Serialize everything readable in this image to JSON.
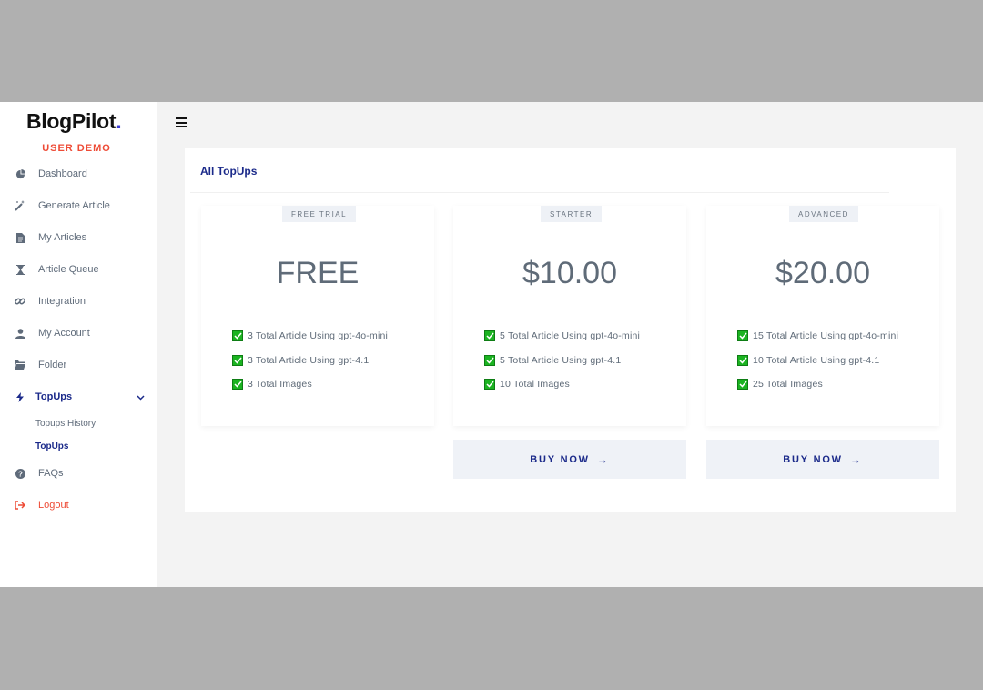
{
  "brand": {
    "name": "BlogPilot",
    "dot": ".",
    "mode": "USER DEMO"
  },
  "sidebar": {
    "items": [
      {
        "label": "Dashboard",
        "icon": "pie-chart-icon"
      },
      {
        "label": "Generate Article",
        "icon": "magic-wand-icon"
      },
      {
        "label": "My Articles",
        "icon": "document-icon"
      },
      {
        "label": "Article Queue",
        "icon": "hourglass-icon"
      },
      {
        "label": "Integration",
        "icon": "link-icon"
      },
      {
        "label": "My Account",
        "icon": "user-icon"
      },
      {
        "label": "Folder",
        "icon": "folder-icon"
      },
      {
        "label": "TopUps",
        "icon": "bolt-icon"
      },
      {
        "label": "FAQs",
        "icon": "question-icon"
      },
      {
        "label": "Logout",
        "icon": "logout-icon"
      }
    ],
    "sub_items": [
      {
        "label": "Topups History"
      },
      {
        "label": "TopUps"
      }
    ]
  },
  "panel": {
    "title": "All TopUps"
  },
  "plans": [
    {
      "badge": "FREE TRIAL",
      "price": "FREE",
      "features": [
        "3 Total Article Using gpt-4o-mini",
        "3 Total Article Using gpt-4.1",
        "3 Total Images"
      ],
      "buy_label": ""
    },
    {
      "badge": "STARTER",
      "price": "$10.00",
      "features": [
        "5 Total Article Using gpt-4o-mini",
        "5 Total Article Using gpt-4.1",
        "10 Total Images"
      ],
      "buy_label": "BUY NOW"
    },
    {
      "badge": "ADVANCED",
      "price": "$20.00",
      "features": [
        "15 Total Article Using gpt-4o-mini",
        "10 Total Article Using gpt-4.1",
        "25 Total Images"
      ],
      "buy_label": "BUY NOW"
    }
  ],
  "colors": {
    "accent": "#1b2a8a",
    "danger": "#ee4b36",
    "check": "#1bb321"
  }
}
